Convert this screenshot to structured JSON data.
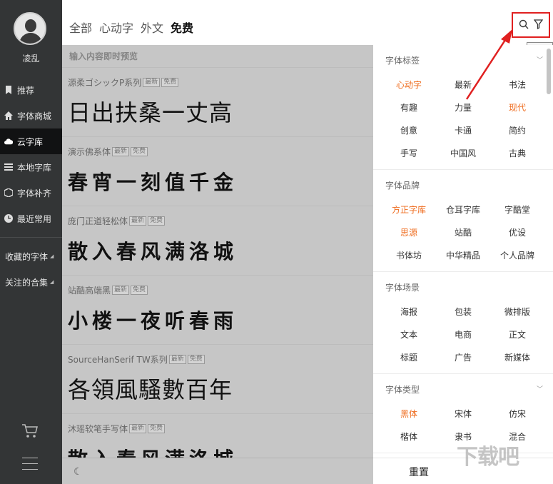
{
  "sidebar": {
    "username": "凌乱",
    "items": [
      {
        "label": "推荐",
        "icon": "bookmark-icon"
      },
      {
        "label": "字体商城",
        "icon": "home-icon"
      },
      {
        "label": "云字库",
        "icon": "cloud-icon"
      },
      {
        "label": "本地字库",
        "icon": "list-icon"
      },
      {
        "label": "字体补齐",
        "icon": "box-icon"
      },
      {
        "label": "最近常用",
        "icon": "clock-icon"
      }
    ],
    "groups": [
      {
        "label": "收藏的字体"
      },
      {
        "label": "关注的合集"
      }
    ]
  },
  "header": {
    "tabs": [
      {
        "label": "全部"
      },
      {
        "label": "心动字"
      },
      {
        "label": "外文"
      },
      {
        "label": "免费"
      }
    ],
    "active_tab": "免费",
    "tooltip": "搜索"
  },
  "list": {
    "hint": "输入内容即时预览",
    "fonts": [
      {
        "name": "源柔ゴシックP系列",
        "badges": [
          "最新",
          "免费"
        ],
        "sample": "日出扶桑一丈高"
      },
      {
        "name": "演示佛系体",
        "badges": [
          "最新",
          "免费"
        ],
        "sample": "春宵一刻值千金"
      },
      {
        "name": "庞门正道轻松体",
        "badges": [
          "最新",
          "免费"
        ],
        "sample": "散入春风满洛城"
      },
      {
        "name": "站酷高端黑",
        "badges": [
          "最新",
          "免费"
        ],
        "sample": "小楼一夜听春雨"
      },
      {
        "name": "SourceHanSerif TW系列",
        "badges": [
          "最新",
          "免费"
        ],
        "sample": "各領風騷數百年"
      },
      {
        "name": "沐瑶软笔手写体",
        "badges": [
          "最新",
          "免费"
        ],
        "sample": "散入春风满洛城"
      }
    ]
  },
  "filters": {
    "sections": [
      {
        "title": "字体标签",
        "items": [
          {
            "label": "心动字",
            "on": true
          },
          {
            "label": "最新"
          },
          {
            "label": "书法"
          },
          {
            "label": "有趣"
          },
          {
            "label": "力量"
          },
          {
            "label": "现代",
            "on": true
          },
          {
            "label": "创意"
          },
          {
            "label": "卡通"
          },
          {
            "label": "简约"
          },
          {
            "label": "手写"
          },
          {
            "label": "中国风"
          },
          {
            "label": "古典"
          }
        ]
      },
      {
        "title": "字体品牌",
        "items": [
          {
            "label": "方正字库",
            "on": true
          },
          {
            "label": "仓耳字库"
          },
          {
            "label": "字酷堂"
          },
          {
            "label": "思源",
            "on": true
          },
          {
            "label": "站酷"
          },
          {
            "label": "优设"
          },
          {
            "label": "书体坊"
          },
          {
            "label": "中华精品"
          },
          {
            "label": "个人品牌"
          }
        ]
      },
      {
        "title": "字体场景",
        "items": [
          {
            "label": "海报"
          },
          {
            "label": "包装"
          },
          {
            "label": "微排版"
          },
          {
            "label": "文本"
          },
          {
            "label": "电商"
          },
          {
            "label": "正文"
          },
          {
            "label": "标题"
          },
          {
            "label": "广告"
          },
          {
            "label": "新媒体"
          }
        ]
      },
      {
        "title": "字体类型",
        "items": [
          {
            "label": "黑体",
            "on": true
          },
          {
            "label": "宋体"
          },
          {
            "label": "仿宋"
          },
          {
            "label": "楷体"
          },
          {
            "label": "隶书"
          },
          {
            "label": "混合"
          }
        ]
      }
    ],
    "reset_label": "重置"
  },
  "colors": {
    "accent_orange": "#ef6c1e",
    "highlight_yellow": "#f5d700",
    "annotation_red": "#e02020"
  },
  "watermark": "下载吧"
}
